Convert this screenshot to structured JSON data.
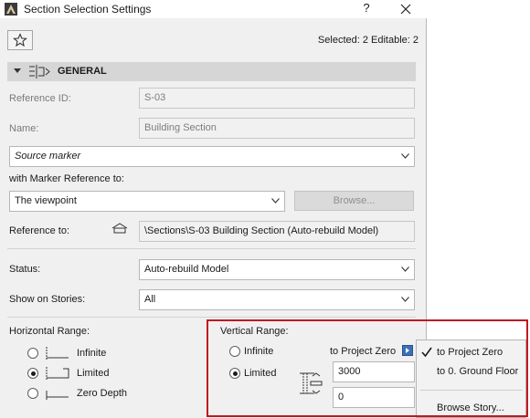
{
  "window": {
    "title": "Section Selection Settings",
    "help": "?"
  },
  "header": {
    "selection_info": "Selected: 2 Editable: 2"
  },
  "section": {
    "title": "GENERAL"
  },
  "fields": {
    "reference_id_label": "Reference ID:",
    "reference_id_value": "S-03",
    "name_label": "Name:",
    "name_value": "Building Section",
    "marker_type": "Source marker",
    "marker_ref_label": "with Marker Reference to:",
    "marker_ref_value": "The viewpoint",
    "browse_label": "Browse...",
    "reference_to_label": "Reference to:",
    "reference_to_value": "\\Sections\\S-03 Building Section (Auto-rebuild Model)",
    "status_label": "Status:",
    "status_value": "Auto-rebuild Model",
    "show_on_stories_label": "Show on Stories:",
    "show_on_stories_value": "All"
  },
  "horizontal_range": {
    "label": "Horizontal Range:",
    "options": [
      "Infinite",
      "Limited",
      "Zero Depth"
    ],
    "selected": "Limited"
  },
  "vertical_range": {
    "label": "Vertical Range:",
    "options": [
      "Infinite",
      "Limited"
    ],
    "selected": "Limited",
    "reference_label": "to Project Zero",
    "top_value": "3000",
    "bottom_value": "0"
  },
  "popup_menu": {
    "items": [
      "to Project Zero",
      "to 0. Ground Floor"
    ],
    "checked": "to Project Zero",
    "browse_story": "Browse Story..."
  },
  "colors": {
    "highlight": "#c0181f",
    "nav_arrow": "#3d6fb6"
  }
}
